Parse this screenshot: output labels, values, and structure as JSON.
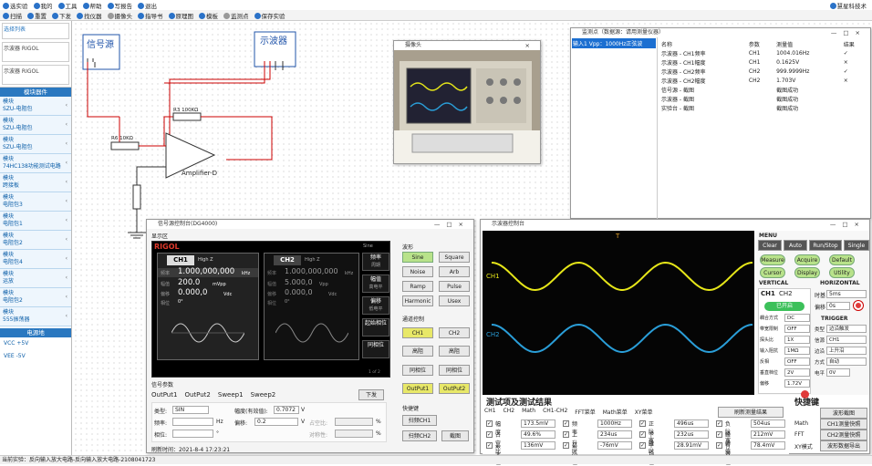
{
  "menu": [
    "选实验",
    "我的",
    "工具",
    "帮助",
    "写报告",
    "退出"
  ],
  "user": "慧星科技术",
  "toolbar": [
    "扫描",
    "重置",
    "下发",
    "找仪器",
    "摄像头",
    "指导书",
    "原理图",
    "模板",
    "监测点",
    "保存实验"
  ],
  "sidebar": {
    "top_items": [
      "选择列表",
      "示波器 RIGOL",
      "示波器 RIGOL"
    ],
    "header": "模块器件",
    "items": [
      [
        "模块",
        "SZU-电阻包"
      ],
      [
        "模块",
        "SZU-电阻包"
      ],
      [
        "模块",
        "SZU-电阻包"
      ],
      [
        "模块",
        "74HC138功能测试电路"
      ],
      [
        "模块",
        "跨接板"
      ],
      [
        "模块",
        "电阻包3"
      ],
      [
        "模块",
        "电阻包1"
      ],
      [
        "模块",
        "电阻包2"
      ],
      [
        "模块",
        "电阻包4"
      ],
      [
        "模块",
        "运放"
      ],
      [
        "模块",
        "电阻包2"
      ],
      [
        "模块",
        "555振荡器"
      ]
    ],
    "header2": "电源地",
    "power": [
      "VCC +5V",
      "VEE -5V"
    ]
  },
  "status": "当前实验：反向输入放大电路-反向输入放大电路-2108041723",
  "schematic": {
    "gen": "信号源",
    "scope": "示波器",
    "r3": "R3 100KΩ",
    "r6": "R6 10KΩ",
    "r": "R6 10KΩ",
    "amp": "Amplifier-D"
  },
  "camera": {
    "title": "摄像头"
  },
  "monitor": {
    "title": "监测点（数据源：请用测量仪器）",
    "left_text": "输入1 Vpp：1000Hz正弦波",
    "headers": [
      "名称",
      "参数",
      "测量值",
      "结果"
    ],
    "rows": [
      [
        "示波器 - CH1频率",
        "CH1",
        "1004.016Hz",
        "✓"
      ],
      [
        "示波器 - CH1幅度",
        "CH1",
        "0.1625V",
        "×"
      ],
      [
        "示波器 - CH2频率",
        "CH2",
        "999.9999Hz",
        "✓"
      ],
      [
        "示波器 - CH2幅度",
        "CH2",
        "1.703V",
        "×"
      ],
      [
        "信号源 - 截图",
        "",
        "截图成功",
        ""
      ],
      [
        "示波器 - 截图",
        "",
        "截图成功",
        ""
      ],
      [
        "实验台 - 截图",
        "",
        "截图成功",
        ""
      ]
    ]
  },
  "gen": {
    "title": "信号源控制台(DG4000)",
    "display": "显示区",
    "brand": "RIGOL",
    "ch1": {
      "name": "CH1",
      "sub": "High Z",
      "freq_label": "频率",
      "freq": "1.000,000,000",
      "freq_unit": "kHz",
      "amp_label": "幅值",
      "amp": "200.0",
      "amp_unit": "mVpp",
      "off_label": "偏移",
      "off": "0.000,0",
      "off_unit": "Vdc",
      "ph_label": "相位",
      "ph": "0°"
    },
    "ch2": {
      "name": "CH2",
      "sub": "High Z",
      "freq_label": "频率",
      "freq": "1.000,000,000",
      "freq_unit": "kHz",
      "amp_label": "幅值",
      "amp": "5.000,0",
      "amp_unit": "Vpp",
      "off_label": "偏移",
      "off": "0.000,0",
      "off_unit": "Vdc",
      "ph_label": "相位",
      "ph": "0°"
    },
    "side_label": "Sine",
    "side_btns": [
      [
        "频率",
        "周期"
      ],
      [
        "幅值",
        "高电平"
      ],
      [
        "偏移",
        "低电平"
      ],
      [
        "起始相位",
        ""
      ],
      [
        "同相位",
        ""
      ]
    ],
    "page": "1 of 2",
    "wave_title": "波形",
    "waves": [
      [
        "Sine",
        "Square"
      ],
      [
        "Noise",
        "Arb"
      ],
      [
        "Ramp",
        "Pulse"
      ],
      [
        "Harmonic",
        "Usex"
      ]
    ],
    "ch_ctrl_title": "通道控制",
    "ch_btns": [
      "CH1",
      "CH2"
    ],
    "hz_btns": [
      "高阻",
      "高阻"
    ],
    "phase_btns": [
      "同相位",
      "同相位"
    ],
    "out_btns": [
      "OutPut1",
      "OutPut2"
    ],
    "shortcut_title": "快捷键",
    "shortcuts": [
      "扫频CH1",
      "扫频CH2",
      "截图"
    ],
    "param_title": "信号参数",
    "tabs": [
      "OutPut1",
      "OutPut2",
      "Sweep1",
      "Sweep2"
    ],
    "send": "下发",
    "type_label": "类型:",
    "type_val": "SIN",
    "freq_label": "频率:",
    "freq_unit": "Hz",
    "phase_label": "相位:",
    "phase_unit": "°",
    "amp_label": "幅度(有效值):",
    "amp_val": "0.7072",
    "amp_unit": "V",
    "offset_label": "偏移:",
    "offset_val": "0.2",
    "offset_unit": "V",
    "duty_label": "占空比:",
    "duty_unit": "%",
    "sym_label": "对称性:",
    "sym_unit": "%",
    "refresh": "刷新时间：2021-8-4 17:23:21"
  },
  "scope": {
    "title": "示波器控制台",
    "ch1": "CH1",
    "ch2": "CH2",
    "trig": "T",
    "ch1_color": "#e6e619",
    "ch2_color": "#2a9ed8",
    "menu": "MENU",
    "row1": [
      "Clear",
      "Auto",
      "Run/Stop",
      "Single"
    ],
    "row2": [
      "Measure",
      "Acquire",
      "Default"
    ],
    "row3": [
      "Cursor",
      "Display",
      "Utility"
    ],
    "vertical": "VERTICAL",
    "horizontal": "HORIZONTAL",
    "tabs": [
      "CH1",
      "CH2"
    ],
    "open": "已开启",
    "time_label": "时基",
    "time_val": "5ms",
    "off_label": "偏移",
    "off_val": "0s",
    "trigger": "TRIGGER",
    "vfields": [
      [
        "耦合方式",
        "DC"
      ],
      [
        "带宽限制",
        "OFF"
      ],
      [
        "探头比",
        "1X"
      ],
      [
        "输入阻抗",
        "1MΩ"
      ],
      [
        "反相",
        "OFF"
      ],
      [
        "垂直档位",
        "2V"
      ],
      [
        "偏移",
        "1.72V"
      ]
    ],
    "tfields": [
      [
        "类型",
        "边沿触发"
      ],
      [
        "信源",
        "CH1"
      ],
      [
        "边沿",
        "上升沿"
      ],
      [
        "方式",
        "自动"
      ],
      [
        "电平",
        "0V"
      ]
    ]
  },
  "measure": {
    "title": "测试项及测试结果",
    "tabs": [
      "CH1",
      "CH2",
      "Math",
      "CH1-CH2",
      "FFT菜单",
      "Math菜单",
      "XY菜单"
    ],
    "refresh": "刷新测量结果",
    "rows": [
      [
        [
          "幅度",
          "173.5mV"
        ],
        [
          "频率",
          "1000Hz"
        ],
        [
          "正脉宽",
          "496us"
        ],
        [
          "负脉宽",
          "504us"
        ]
      ],
      [
        [
          "占空比",
          "49.6%"
        ],
        [
          "上升时间",
          "234us"
        ],
        [
          "下降时间",
          "232us"
        ],
        [
          "峰峰值",
          "212mV"
        ]
      ],
      [
        [
          "最大值",
          "136mV"
        ],
        [
          "最小值",
          "-76mV"
        ],
        [
          "平均值",
          "28.91mV"
        ],
        [
          "有效值",
          "78.4mV"
        ]
      ]
    ],
    "shortcut_title": "快捷键",
    "shortcuts": [
      [
        "",
        "波形截图"
      ],
      [
        "Math",
        "CH1测量快照"
      ],
      [
        "FFT",
        "CH2测量快照"
      ],
      [
        "XY模式",
        "波形数据导出"
      ]
    ]
  }
}
